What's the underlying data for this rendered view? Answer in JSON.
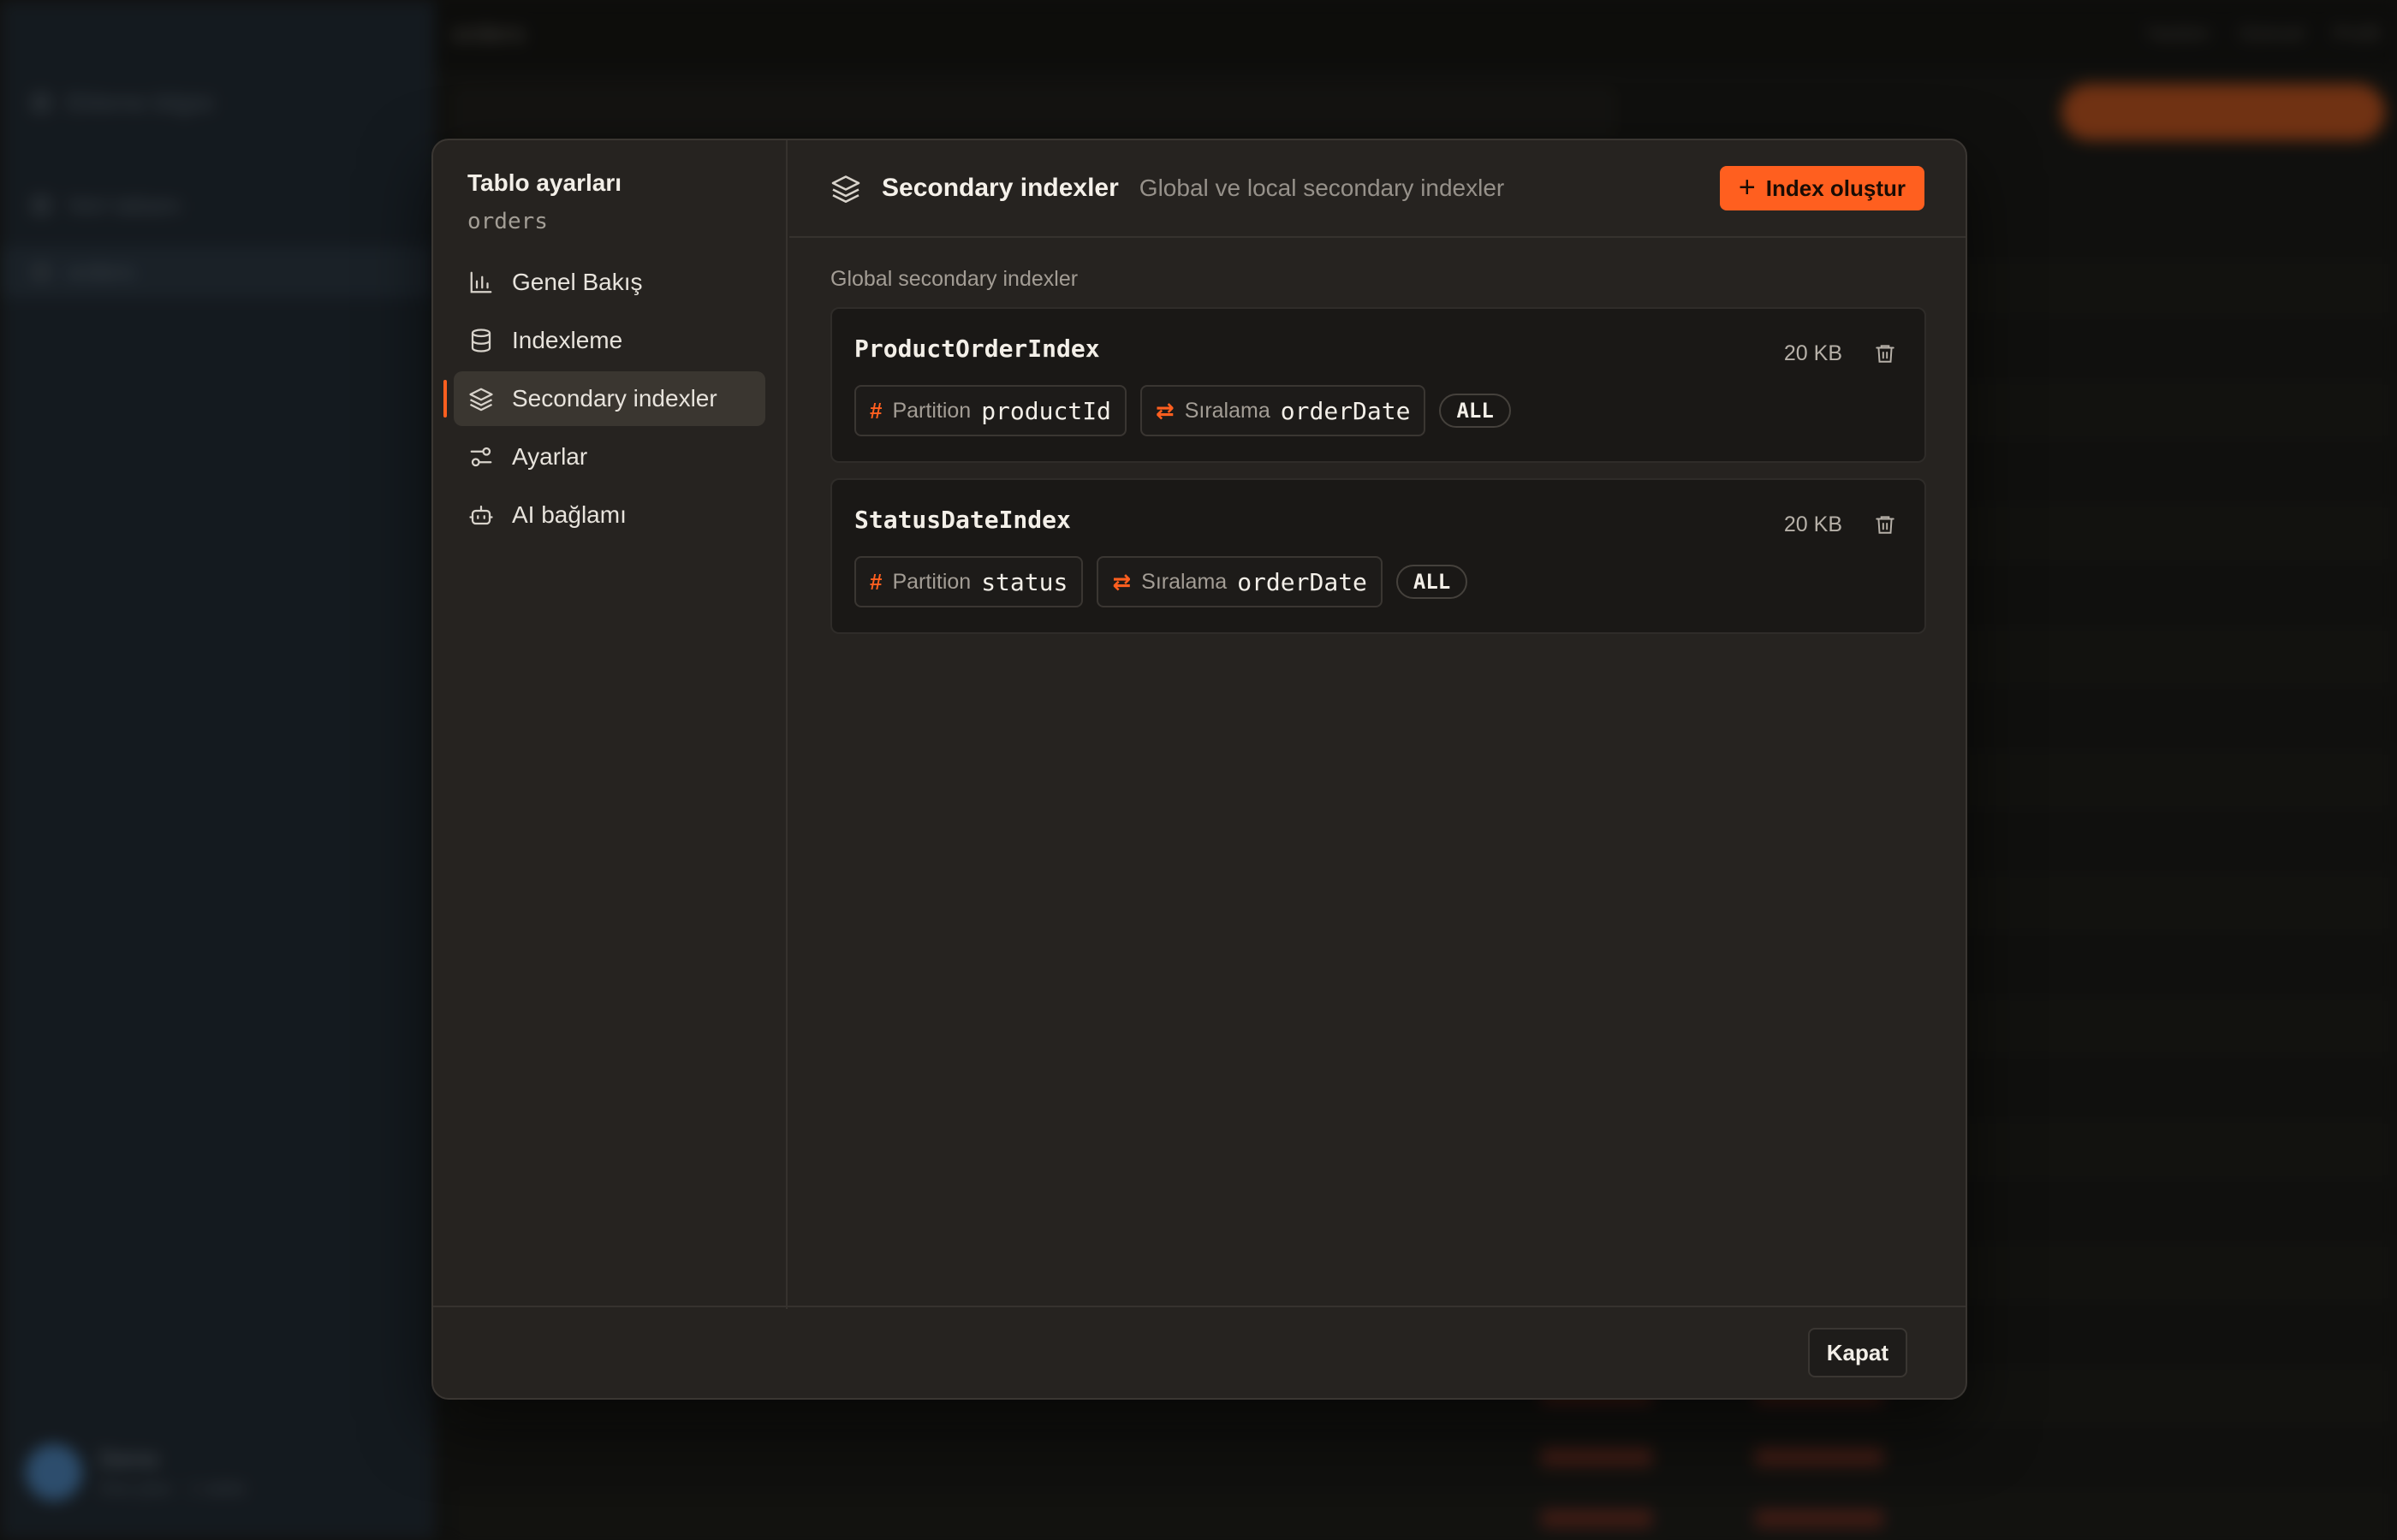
{
  "background": {
    "sidebar_items": [
      "Ekleme bilgisi",
      "Veri tabanı",
      "orders"
    ],
    "user_name": "Demo",
    "user_sub": "free plan · 1 table",
    "table_title": "orders",
    "top_right": [
      "Yardım",
      "Güncel",
      "Profil"
    ]
  },
  "dialog": {
    "sidebar": {
      "title": "Tablo ayarları",
      "table_name": "orders",
      "items": [
        {
          "label": "Genel Bakış",
          "icon": "bar-chart-icon",
          "active": false
        },
        {
          "label": "Indexleme",
          "icon": "database-icon",
          "active": false
        },
        {
          "label": "Secondary indexler",
          "icon": "layers-icon",
          "active": true
        },
        {
          "label": "Ayarlar",
          "icon": "sliders-icon",
          "active": false
        },
        {
          "label": "AI bağlamı",
          "icon": "bot-icon",
          "active": false
        }
      ]
    },
    "header": {
      "title": "Secondary indexler",
      "description": "Global ve local secondary indexler",
      "create_button": "Index oluştur"
    },
    "section_label": "Global secondary indexler",
    "indexes": [
      {
        "name": "ProductOrderIndex",
        "size": "20 KB",
        "partition_label": "Partition",
        "partition_key": "productId",
        "sort_label": "Sıralama",
        "sort_key": "orderDate",
        "projection": "ALL"
      },
      {
        "name": "StatusDateIndex",
        "size": "20 KB",
        "partition_label": "Partition",
        "partition_key": "status",
        "sort_label": "Sıralama",
        "sort_key": "orderDate",
        "projection": "ALL"
      }
    ],
    "footer": {
      "close_button": "Kapat"
    }
  },
  "colors": {
    "accent": "#ff5f1f",
    "dialog_bg": "#262320",
    "card_bg": "#1a1816"
  }
}
